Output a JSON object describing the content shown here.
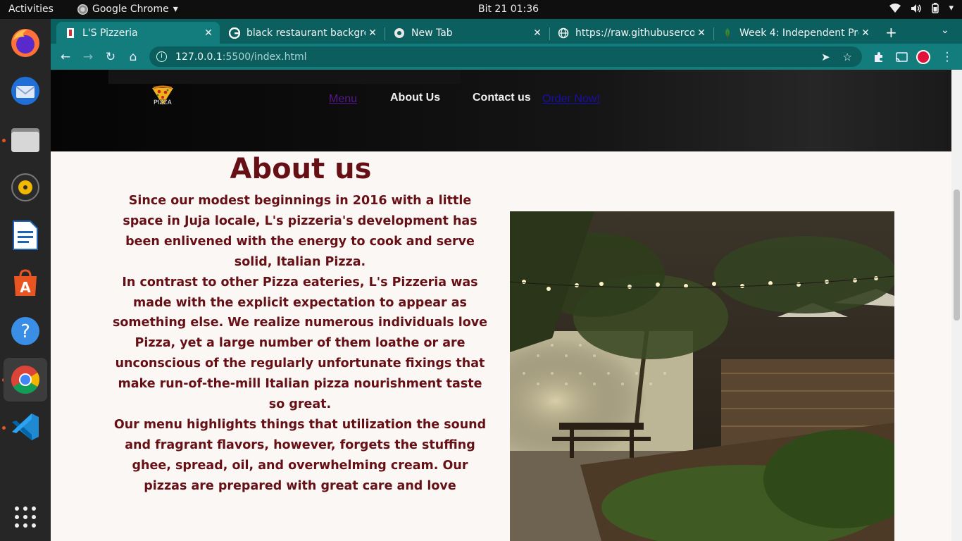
{
  "topbar": {
    "activities": "Activities",
    "app_name": "Google Chrome",
    "clock": "Bit 21  01:36"
  },
  "dock": {
    "apps": [
      "firefox",
      "thunderbird",
      "files",
      "rhythmbox",
      "libreoffice-writer",
      "ubuntu-software",
      "help",
      "google-chrome",
      "vscode",
      "show-applications"
    ]
  },
  "browser": {
    "tabs": [
      {
        "title": "L'S Pizzeria",
        "active": true
      },
      {
        "title": "black restaurant backgro",
        "active": false
      },
      {
        "title": "New Tab",
        "active": false
      },
      {
        "title": "https://raw.githubuserco",
        "active": false
      },
      {
        "title": "Week 4: Independent Pro",
        "active": false
      }
    ],
    "url_host": "127.0.0.1",
    "url_rest": ":5500/index.html"
  },
  "page": {
    "nav": {
      "menu": "Menu",
      "about": "About Us",
      "contact": "Contact us",
      "order": "Order Now!"
    },
    "logo_text": "PIZZA",
    "about_title": "About us",
    "paragraphs": [
      "Since our modest beginnings in 2016 with a little space in Juja locale, L's pizzeria's development has been enlivened with the energy to cook and serve solid, Italian Pizza.",
      "In contrast to other Pizza eateries, L's Pizzeria was made with the explicit expectation to appear as something else. We realize numerous individuals love Pizza, yet a large number of them loathe or are unconscious of the regularly unfortunate fixings that make run-of-the-mill Italian pizza nourishment taste so great.",
      "Our menu highlights things that utilization the sound and fragrant flavors, however, forgets the stuffing ghee, spread, oil, and overwhelming cream. Our pizzas are prepared with great care and love"
    ]
  },
  "colors": {
    "tab_strip": "#0b5f5f",
    "toolbar": "#137d7e",
    "heading": "#661016"
  }
}
